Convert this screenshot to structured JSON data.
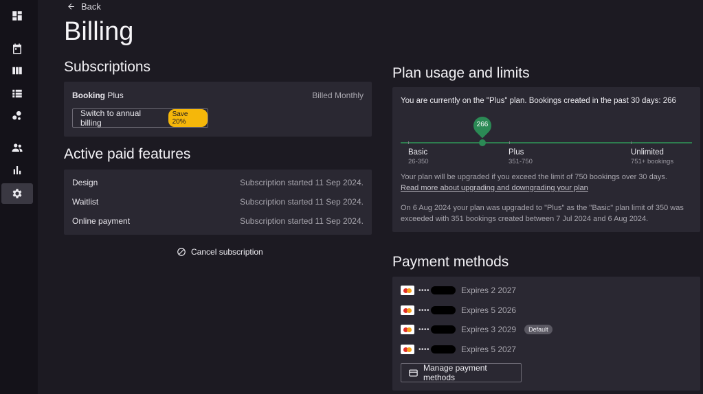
{
  "nav": {
    "items": [
      {
        "icon": "dashboard-icon"
      },
      {
        "icon": "calendar-icon"
      },
      {
        "icon": "columns-icon"
      },
      {
        "icon": "list-icon"
      },
      {
        "icon": "bubble-chart-icon"
      },
      {
        "icon": "people-icon"
      },
      {
        "icon": "bar-chart-icon"
      },
      {
        "icon": "gear-icon",
        "active": true
      }
    ]
  },
  "header": {
    "back_label": "Back",
    "title": "Billing"
  },
  "subscriptions": {
    "heading": "Subscriptions",
    "product_name": "Booking",
    "plan_name": "Plus",
    "billing_period": "Billed Monthly",
    "switch_button": "Switch to annual billing",
    "save_badge": "Save 20%"
  },
  "features": {
    "heading": "Active paid features",
    "rows": [
      {
        "name": "Design",
        "status": "Subscription started 11 Sep 2024."
      },
      {
        "name": "Waitlist",
        "status": "Subscription started 11 Sep 2024."
      },
      {
        "name": "Online payment",
        "status": "Subscription started 11 Sep 2024."
      }
    ],
    "cancel_label": "Cancel subscription"
  },
  "usage": {
    "heading": "Plan usage and limits",
    "summary": "You are currently on the \"Plus\" plan. Bookings created in the past 30 days: 266",
    "marker_value": "266",
    "tiers": [
      {
        "name": "Basic",
        "range": "26-350"
      },
      {
        "name": "Plus",
        "range": "351-750"
      },
      {
        "name": "Unlimited",
        "range": "751+ bookings"
      }
    ],
    "upgrade_note": "Your plan will be upgraded if you exceed the limit of 750 bookings over 30 days.",
    "read_more_link": "Read more about upgrading and downgrading your plan",
    "history_line1": "On 6 Aug 2024 your plan was upgraded to \"Plus\" as the \"Basic\" plan limit of 350 was",
    "history_line2": "exceeded with 351 bookings created between 7 Jul 2024 and 6 Aug 2024."
  },
  "payment": {
    "heading": "Payment methods",
    "cards": [
      {
        "masked": "••••",
        "expires": "Expires 2 2027",
        "default": ""
      },
      {
        "masked": "••••",
        "expires": "Expires 5 2026",
        "default": ""
      },
      {
        "masked": "••••",
        "expires": "Expires 3 2029",
        "default": "Default"
      },
      {
        "masked": "••••",
        "expires": "Expires 5 2027",
        "default": ""
      }
    ],
    "manage_button": "Manage payment methods"
  },
  "colors": {
    "background": "#1c1a22",
    "card": "#2a2832",
    "accent_green": "#2b8a55",
    "save_badge": "#f5b70a"
  }
}
